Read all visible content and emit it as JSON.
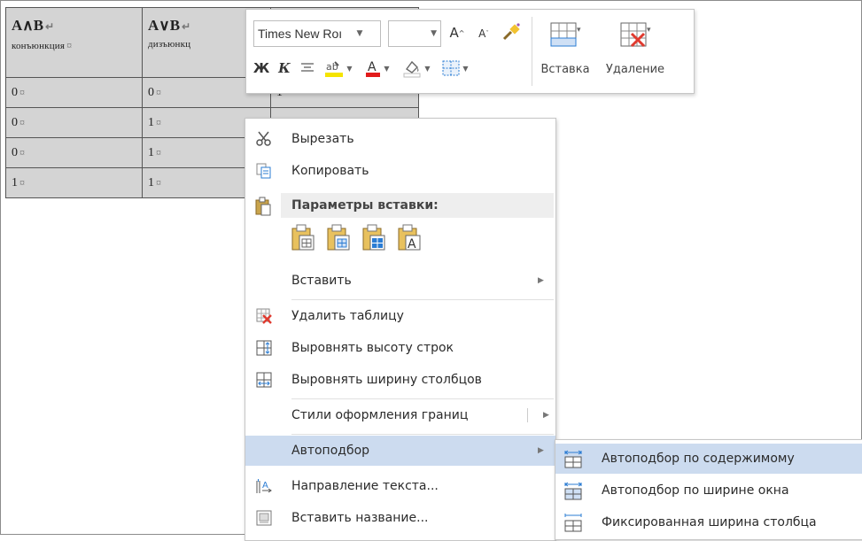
{
  "table": {
    "headers": [
      {
        "main": "A∧B",
        "sub": "конъюнкция"
      },
      {
        "main": "A∨B",
        "sub": "дизъюнкц"
      },
      {
        "main": "",
        "sub": ""
      }
    ],
    "rows": [
      [
        "0",
        "0",
        "1"
      ],
      [
        "0",
        "1",
        ""
      ],
      [
        "0",
        "1",
        ""
      ],
      [
        "1",
        "1",
        ""
      ]
    ],
    "pilcrow": "¤",
    "return_mark": "↵"
  },
  "mini_toolbar": {
    "font_name": "Times New Roı",
    "font_size": "",
    "bold": "Ж",
    "italic": "К",
    "insert_label": "Вставка",
    "delete_label": "Удаление",
    "highlight_color": "#f5e400",
    "font_color": "#e21b1b",
    "accent_color": "#2b7cd3"
  },
  "context_menu": {
    "cut": "Вырезать",
    "copy": "Копировать",
    "paste_options": "Параметры вставки:",
    "insert": "Вставить",
    "delete_table": "Удалить таблицу",
    "distribute_rows": "Выровнять высоту строк",
    "distribute_cols": "Выровнять ширину столбцов",
    "border_styles": "Стили оформления границ",
    "autofit": "Автоподбор",
    "text_direction": "Направление текста...",
    "insert_caption": "Вставить название..."
  },
  "autofit_submenu": {
    "contents": "Автоподбор по содержимому",
    "window": "Автоподбор по ширине окна",
    "fixed": "Фиксированная ширина столбца"
  },
  "colors": {
    "menu_highlight": "#ccdbef",
    "table_fill": "#d4d4d4"
  }
}
